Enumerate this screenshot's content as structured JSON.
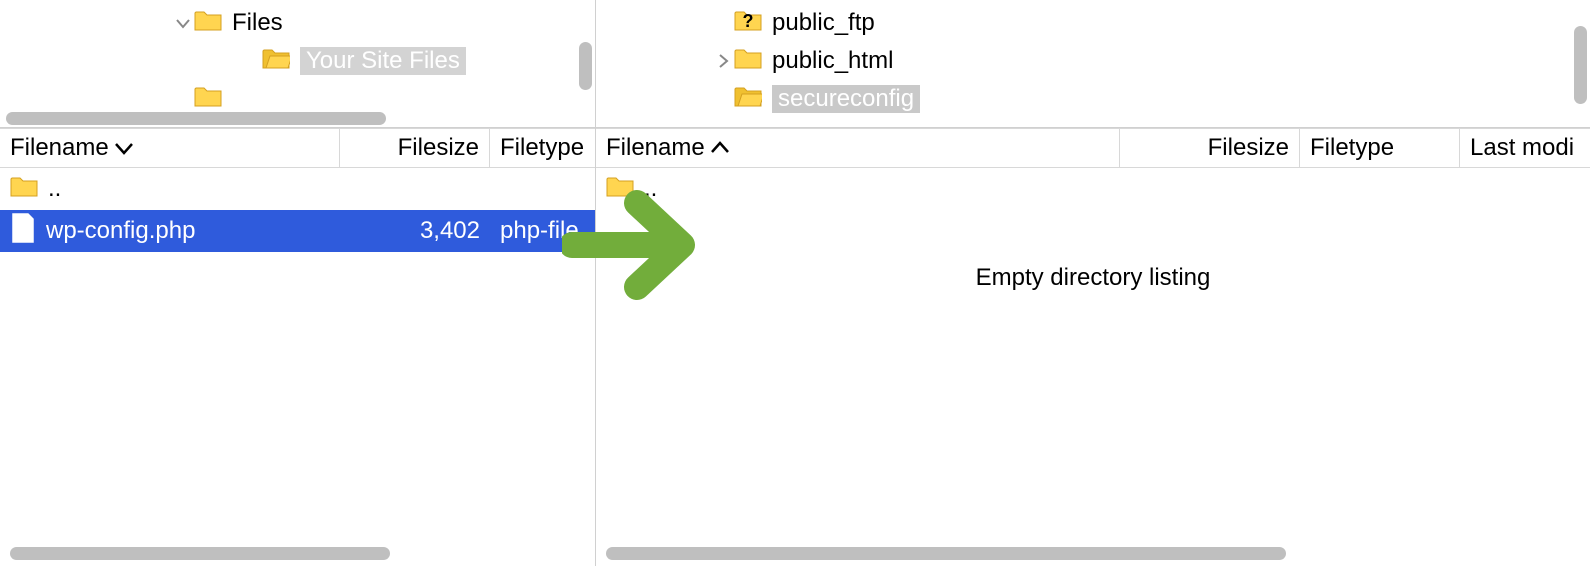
{
  "left": {
    "tree": {
      "items": [
        {
          "label": "Files",
          "indent": 172,
          "expander": "down",
          "folder": "closed",
          "selected": false
        },
        {
          "label": "Your Site Files",
          "indent": 240,
          "expander": "",
          "folder": "open",
          "selected": true
        },
        {
          "label": "",
          "indent": 172,
          "expander": "",
          "folder": "closed",
          "selected": false
        }
      ]
    },
    "cols": {
      "filename": "Filename",
      "filesize": "Filesize",
      "filetype": "Filetype",
      "sort": "desc"
    },
    "files": [
      {
        "name": "..",
        "size": "",
        "type": "",
        "icon": "folder"
      },
      {
        "name": "wp-config.php",
        "size": "3,402",
        "type": "php-file",
        "icon": "file",
        "selected": true
      }
    ]
  },
  "right": {
    "tree": {
      "items": [
        {
          "label": "public_ftp",
          "indent": 756,
          "expander": "",
          "folder": "question",
          "selected": false
        },
        {
          "label": "public_html",
          "indent": 756,
          "expander": "right",
          "folder": "closed",
          "selected": false
        },
        {
          "label": "secureconfig",
          "indent": 756,
          "expander": "",
          "folder": "open",
          "selected": true
        }
      ]
    },
    "cols": {
      "filename": "Filename",
      "filesize": "Filesize",
      "filetype": "Filetype",
      "lastmod": "Last modi",
      "sort": "asc"
    },
    "files": [
      {
        "name": "..",
        "size": "",
        "type": "",
        "icon": "folder"
      }
    ],
    "empty_msg": "Empty directory listing"
  }
}
